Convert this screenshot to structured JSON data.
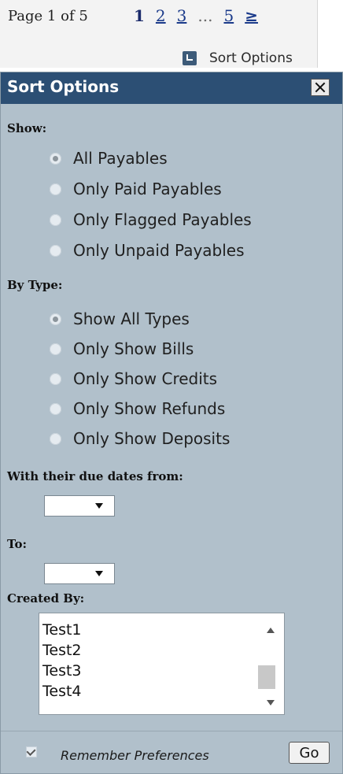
{
  "pager": {
    "page_label": "Page 1 of 5",
    "links": [
      "1",
      "2",
      "3",
      "...",
      "5",
      "≥"
    ],
    "sort_options_link": "Sort Options"
  },
  "panel": {
    "title": "Sort Options",
    "show": {
      "label": "Show:",
      "options": [
        "All Payables",
        "Only Paid Payables",
        "Only Flagged Payables",
        "Only Unpaid Payables"
      ],
      "selected": "All Payables"
    },
    "by_type": {
      "label": "By Type:",
      "options": [
        "Show All Types",
        "Only Show Bills",
        "Only Show Credits",
        "Only Show Refunds",
        "Only Show Deposits"
      ],
      "selected": "Show All Types"
    },
    "due_from": {
      "label": "With their due dates from:",
      "value": ""
    },
    "due_to": {
      "label": "To:",
      "value": ""
    },
    "created_by": {
      "label": "Created By:",
      "items": [
        "Test1",
        "Test2",
        "Test3",
        "Test4"
      ]
    },
    "remember": {
      "label": "Remember Preferences",
      "checked": true
    },
    "go_label": "Go"
  },
  "colors": {
    "header": "#2c4f74",
    "panel_bg": "#b1c0cb",
    "link": "#1a3a8a"
  }
}
